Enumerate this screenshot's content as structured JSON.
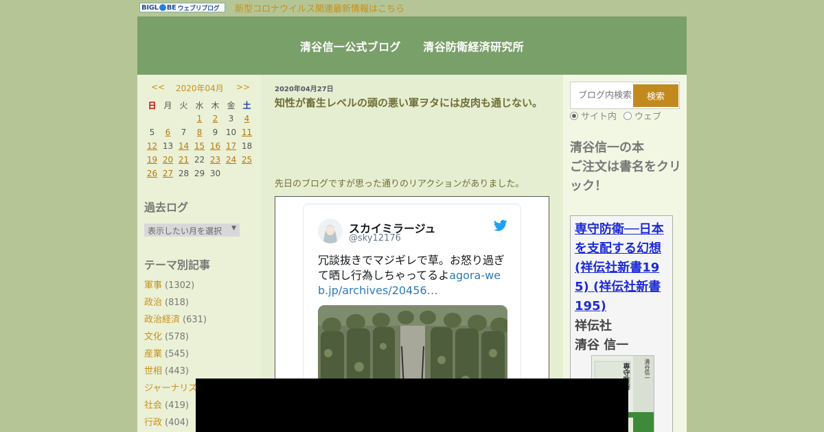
{
  "topbar": {
    "logo_text": "BIGL",
    "logo_text2": "BE",
    "logo_sub": "ウェブリブログ",
    "notice_link": "新型コロナウイルス関連最新情報はこちら"
  },
  "header": {
    "title": "清谷信一公式ブログ　　清谷防衛経済研究所"
  },
  "calendar": {
    "prev": "<<",
    "month": "2020年04月",
    "next": ">>",
    "weekdays": [
      "日",
      "月",
      "火",
      "水",
      "木",
      "金",
      "土"
    ],
    "rows": [
      [
        "",
        "",
        "",
        "1",
        "2",
        "3",
        "4"
      ],
      [
        "5",
        "6",
        "7",
        "8",
        "9",
        "10",
        "11"
      ],
      [
        "12",
        "13",
        "14",
        "15",
        "16",
        "17",
        "18"
      ],
      [
        "19",
        "20",
        "21",
        "22",
        "23",
        "24",
        "25"
      ],
      [
        "26",
        "27",
        "28",
        "29",
        "30",
        "",
        ""
      ]
    ],
    "linked_days": [
      "1",
      "2",
      "4",
      "6",
      "8",
      "11",
      "12",
      "14",
      "15",
      "16",
      "17",
      "19",
      "20",
      "21",
      "23",
      "24",
      "25",
      "26",
      "27"
    ]
  },
  "archive": {
    "heading": "過去ログ",
    "select_label": "表示したい月を選択"
  },
  "themes": {
    "heading": "テーマ別記事",
    "items": [
      {
        "label": "軍事",
        "count": "(1302)"
      },
      {
        "label": "政治",
        "count": "(818)"
      },
      {
        "label": "政治経済",
        "count": "(631)"
      },
      {
        "label": "文化",
        "count": "(578)"
      },
      {
        "label": "産業",
        "count": "(545)"
      },
      {
        "label": "世相",
        "count": "(443)"
      },
      {
        "label": "ジャーナリズム",
        "count": ""
      },
      {
        "label": "社会",
        "count": "(419)"
      },
      {
        "label": "行政",
        "count": "(404)"
      }
    ]
  },
  "post": {
    "date": "2020年04月27日",
    "title": "知性が畜生レベルの頭の悪い軍ヲタには皮肉も通じない。",
    "intro": "先日のブログですが思った通りのリアクションがありました。"
  },
  "tweet": {
    "name": "スカイミラージュ",
    "handle": "@sky12176",
    "text": "冗談抜きでマジギレで草。お怒り過ぎて晒し行為しちゃってるよ",
    "link": "agora-web.jp/archives/20456…"
  },
  "search": {
    "placeholder": "ブログ内検索",
    "button": "検索",
    "scope_site": "サイト内",
    "scope_web": "ウェブ"
  },
  "books": {
    "heading": "清谷信一の本\nご注文は書名をクリック！",
    "title_link": "専守防衛──日本を支配する幻想 (祥伝社新書195) (祥伝社新書 195)",
    "publisher": "祥伝社",
    "author": "清谷 信一",
    "cover_text": "専守防衛",
    "cover_author": "清谷信一"
  },
  "colors": {
    "header_bg": "#7aa06a",
    "link_gold": "#c8901a",
    "search_button": "#c28a1e",
    "sunday": "#cc0000",
    "saturday": "#1a3cb0"
  }
}
